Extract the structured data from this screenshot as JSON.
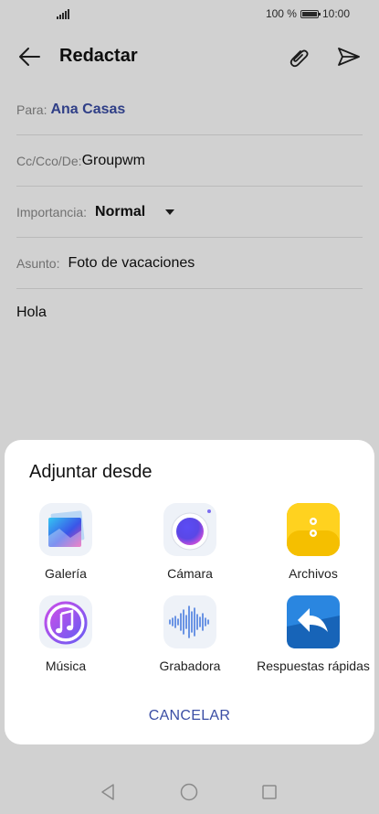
{
  "status": {
    "battery": "100 %",
    "time": "10:00"
  },
  "toolbar": {
    "title": "Redactar"
  },
  "form": {
    "to_label": "Para:",
    "to_value": "Ana Casas",
    "cc_label": "Cc/Cco/De:",
    "cc_value": "Groupwm",
    "importance_label": "Importancia:",
    "importance_value": "Normal",
    "subject_label": "Asunto:",
    "subject_value": "Foto de vacaciones",
    "body": "Hola"
  },
  "sheet": {
    "title": "Adjuntar desde",
    "options": [
      {
        "label": "Galería",
        "icon": "gallery-icon"
      },
      {
        "label": "Cámara",
        "icon": "camera-icon"
      },
      {
        "label": "Archivos",
        "icon": "files-icon"
      },
      {
        "label": "Música",
        "icon": "music-icon"
      },
      {
        "label": "Grabadora",
        "icon": "recorder-icon"
      },
      {
        "label": "Respuestas rápidas",
        "icon": "quick-reply-icon"
      }
    ],
    "cancel": "CANCELAR"
  },
  "colors": {
    "accent": "#3b4ea5",
    "overlay": "#d1d1d1"
  }
}
